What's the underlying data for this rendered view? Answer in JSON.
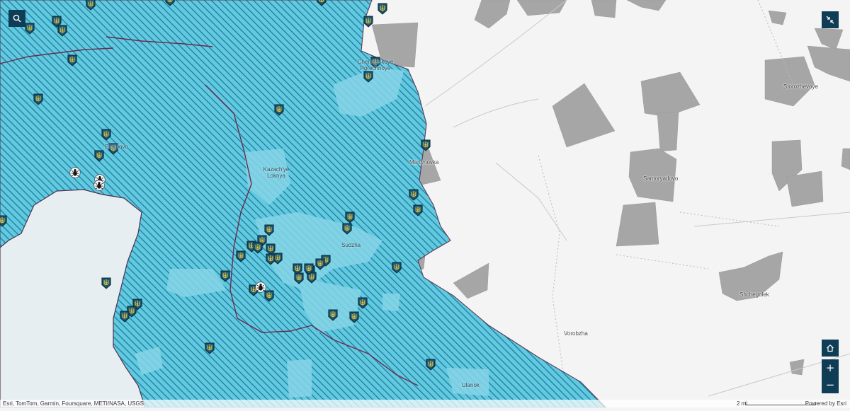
{
  "map": {
    "colors": {
      "land": "#f4f4f4",
      "block": "#a8a8a8",
      "occupied_fill": "#5cc6de",
      "hatch": "#1a7f9a",
      "town": "#7fd0e6",
      "water": "#e4eff4",
      "border": "#6a2a4e",
      "control": "#0e3d55"
    },
    "places": [
      {
        "id": "cherkasskoye",
        "text": "Cherkasskoye\nPorechnoye",
        "dark": true
      },
      {
        "id": "kazachye",
        "text": "Kazach'ye\nLoknya",
        "dark": true
      },
      {
        "id": "martynovka",
        "text": "Martynovka",
        "dark": false
      },
      {
        "id": "sudzha",
        "text": "Sudzha",
        "dark": true
      },
      {
        "id": "plekhovo",
        "text": "Plekhovo",
        "dark": true
      },
      {
        "id": "storozhevoye",
        "text": "Storozhevoye",
        "dark": false
      },
      {
        "id": "samoryadovo",
        "text": "Samoryadovo",
        "dark": false
      },
      {
        "id": "shchegolek",
        "text": "Shchegolek",
        "dark": false
      },
      {
        "id": "vorobzha",
        "text": "Vorobzha",
        "dark": false
      },
      {
        "id": "ulanok",
        "text": "Ulanok",
        "dark": true
      }
    ],
    "markers": {
      "trident_icon": "trident-icon",
      "bug_icon": "bug-icon",
      "trident_count": 58,
      "bug_count": 4
    }
  },
  "controls": {
    "search_icon": "search-icon",
    "expand_icon": "collapse-icon",
    "home_icon": "home-icon",
    "zoom_in_label": "+",
    "zoom_out_label": "−"
  },
  "attribution": {
    "left": "Esri, TomTom, Garmin, Foursquare, METI/NASA, USGS",
    "right": "Powered by Esri"
  },
  "scale": {
    "label": "2 mi"
  }
}
